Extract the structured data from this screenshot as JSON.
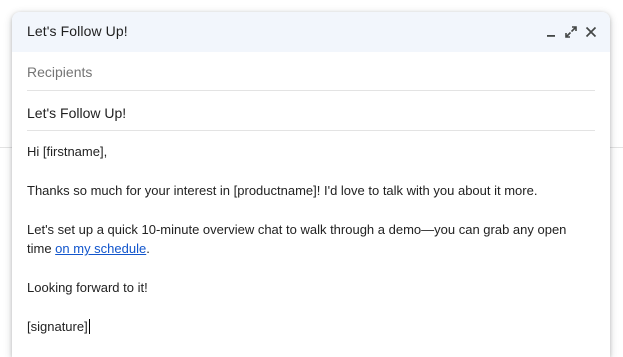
{
  "compose": {
    "title": "Let's Follow Up!",
    "recipients_placeholder": "Recipients",
    "subject": "Let's Follow Up!",
    "body": {
      "greeting": "Hi [firstname],",
      "paragraph1": "Thanks so much for your interest in [productname]! I'd love to talk with you about it more.",
      "paragraph2_line1": "Let's set up a quick 10-minute overview chat to walk through a demo—you can grab any open",
      "paragraph2_line2_prefix": "time ",
      "paragraph2_link": "on my schedule",
      "paragraph2_suffix": ".",
      "closing": "Looking forward to it!",
      "signature": "[signature]"
    }
  },
  "icons": {
    "minimize": "minimize-icon",
    "expand": "expand-icon",
    "close": "close-icon"
  },
  "colors": {
    "header_bg": "#f2f6fc",
    "link": "#1155cc",
    "label": "#757575",
    "divider": "#e3e3e3"
  }
}
